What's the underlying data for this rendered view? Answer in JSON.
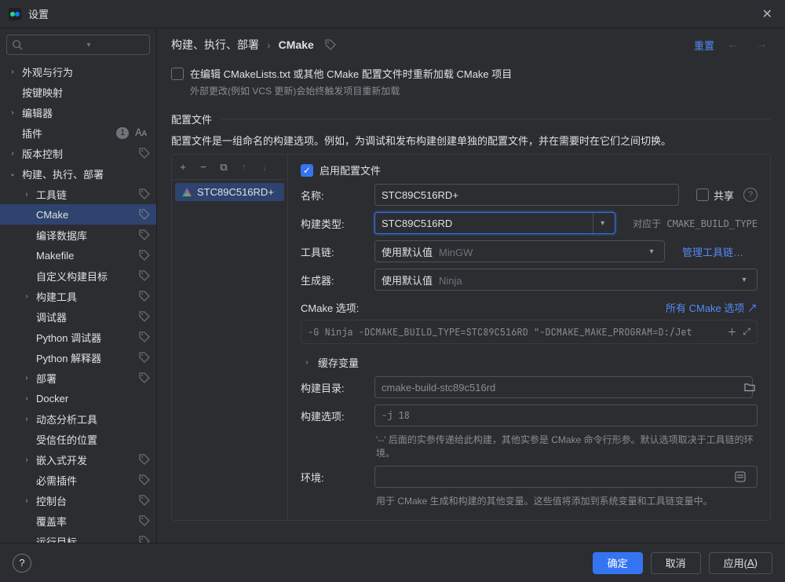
{
  "window": {
    "title": "设置"
  },
  "header": {
    "breadcrumbs": [
      "构建、执行、部署",
      "CMake"
    ],
    "reset": "重置",
    "tag_icon": "tag"
  },
  "search": {
    "placeholder": ""
  },
  "sidebar": [
    {
      "label": "外观与行为",
      "indent": 0,
      "chev": "right",
      "tag": false
    },
    {
      "label": "按键映射",
      "indent": 0,
      "chev": "none",
      "tag": false
    },
    {
      "label": "编辑器",
      "indent": 0,
      "chev": "right",
      "tag": false
    },
    {
      "label": "插件",
      "indent": 0,
      "chev": "none",
      "tag": false,
      "badge": "1",
      "lang": true
    },
    {
      "label": "版本控制",
      "indent": 0,
      "chev": "right",
      "tag": true
    },
    {
      "label": "构建、执行、部署",
      "indent": 0,
      "chev": "down",
      "tag": false
    },
    {
      "label": "工具链",
      "indent": 1,
      "chev": "right",
      "tag": true
    },
    {
      "label": "CMake",
      "indent": 1,
      "chev": "none",
      "tag": true,
      "selected": true
    },
    {
      "label": "编译数据库",
      "indent": 1,
      "chev": "none",
      "tag": true
    },
    {
      "label": "Makefile",
      "indent": 1,
      "chev": "none",
      "tag": true
    },
    {
      "label": "自定义构建目标",
      "indent": 1,
      "chev": "none",
      "tag": true
    },
    {
      "label": "构建工具",
      "indent": 1,
      "chev": "right",
      "tag": true
    },
    {
      "label": "调试器",
      "indent": 1,
      "chev": "none",
      "tag": true
    },
    {
      "label": "Python 调试器",
      "indent": 1,
      "chev": "none",
      "tag": true
    },
    {
      "label": "Python 解释器",
      "indent": 1,
      "chev": "none",
      "tag": true
    },
    {
      "label": "部署",
      "indent": 1,
      "chev": "right",
      "tag": true
    },
    {
      "label": "Docker",
      "indent": 1,
      "chev": "right",
      "tag": false
    },
    {
      "label": "动态分析工具",
      "indent": 1,
      "chev": "right",
      "tag": false
    },
    {
      "label": "受信任的位置",
      "indent": 1,
      "chev": "none",
      "tag": false
    },
    {
      "label": "嵌入式开发",
      "indent": 1,
      "chev": "right",
      "tag": true
    },
    {
      "label": "必需插件",
      "indent": 1,
      "chev": "none",
      "tag": true
    },
    {
      "label": "控制台",
      "indent": 1,
      "chev": "right",
      "tag": true
    },
    {
      "label": "覆盖率",
      "indent": 1,
      "chev": "none",
      "tag": true
    },
    {
      "label": "运行目标",
      "indent": 1,
      "chev": "none",
      "tag": true
    }
  ],
  "reload": {
    "label": "在编辑 CMakeLists.txt 或其他 CMake 配置文件时重新加载 CMake 项目",
    "hint": "外部更改(例如 VCS 更新)会始终触发项目重新加载"
  },
  "profiles_section": {
    "title": "配置文件",
    "desc": "配置文件是一组命名的构建选项。例如，为调试和发布构建创建单独的配置文件，并在需要时在它们之间切换。"
  },
  "profile_list": {
    "items": [
      "STC89C516RD+"
    ]
  },
  "toolbar_icons": {
    "add": "+",
    "remove": "−",
    "copy": "⧉",
    "up": "↑",
    "down": "↓"
  },
  "form": {
    "enable": "启用配置文件",
    "name_label": "名称:",
    "name_value": "STC89C516RD+",
    "share": "共享",
    "build_type_label": "构建类型:",
    "build_type_value": "STC89C516RD",
    "build_type_hint": "对应于 CMAKE_BUILD_TYPE",
    "toolchain_label": "工具链:",
    "toolchain_prefix": "使用默认值",
    "toolchain_value": "MinGW",
    "toolchain_link": "管理工具链…",
    "generator_label": "生成器:",
    "generator_prefix": "使用默认值",
    "generator_value": "Ninja",
    "cmake_options_label": "CMake 选项:",
    "cmake_options_link": "所有 CMake 选项 ↗",
    "cmake_options_value": "-G Ninja -DCMAKE_BUILD_TYPE=STC89C516RD \"-DCMAKE_MAKE_PROGRAM=D:/Jet",
    "cache_vars": "缓存变量",
    "build_dir_label": "构建目录:",
    "build_dir_value": "cmake-build-stc89c516rd",
    "build_opts_label": "构建选项:",
    "build_opts_value": "-j 18",
    "build_opts_hint": "'--' 后面的实参传递给此构建，其他实参是 CMake 命令行形参。默认选项取决于工具链的环境。",
    "env_label": "环境:",
    "env_value": "",
    "env_hint": "用于 CMake 生成和构建的其他变量。这些值将添加到系统变量和工具链变量中。"
  },
  "footer": {
    "ok": "确定",
    "cancel": "取消",
    "apply": "应用(",
    "apply_u": "A",
    "apply_suffix": ")"
  }
}
